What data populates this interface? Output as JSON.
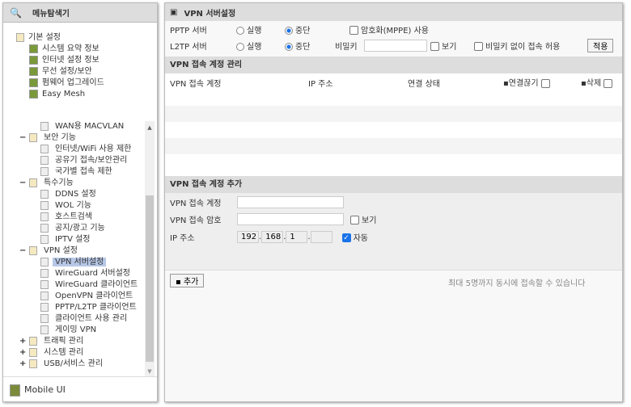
{
  "sidebar": {
    "title": "메뉴탐색기",
    "top_group": "기본 설정",
    "top_items": [
      "시스템 요약 정보",
      "인터넷 설정 정보",
      "무선 설정/보안",
      "펌웨어 업그레이드",
      "Easy Mesh"
    ],
    "scroll_items": [
      {
        "label": "WAN용 MACVLAN",
        "level": 2
      },
      {
        "label": "보안 기능",
        "level": 1,
        "toggle": "−"
      },
      {
        "label": "인터넷/WiFi 사용 제한",
        "level": 2
      },
      {
        "label": "공유기 접속/보안관리",
        "level": 2
      },
      {
        "label": "국가별 접속 제한",
        "level": 2
      },
      {
        "label": "특수기능",
        "level": 1,
        "toggle": "−"
      },
      {
        "label": "DDNS 설정",
        "level": 2
      },
      {
        "label": "WOL 기능",
        "level": 2
      },
      {
        "label": "호스트검색",
        "level": 2
      },
      {
        "label": "공지/광고 기능",
        "level": 2
      },
      {
        "label": "IPTV 설정",
        "level": 2
      },
      {
        "label": "VPN 설정",
        "level": 1,
        "toggle": "−"
      },
      {
        "label": "VPN 서버설정",
        "level": 2,
        "selected": true
      },
      {
        "label": "WireGuard 서버설정",
        "level": 2
      },
      {
        "label": "WireGuard 클라이언트",
        "level": 2
      },
      {
        "label": "OpenVPN 클라이언트",
        "level": 2
      },
      {
        "label": "PPTP/L2TP 클라이언트",
        "level": 2
      },
      {
        "label": "클라이언트 사용 관리",
        "level": 2
      },
      {
        "label": "게이밍 VPN",
        "level": 2
      },
      {
        "label": "트래픽 관리",
        "level": 1,
        "toggle": "+"
      },
      {
        "label": "시스템 관리",
        "level": 1,
        "toggle": "+"
      },
      {
        "label": "USB/서비스 관리",
        "level": 1,
        "toggle": "+"
      }
    ],
    "mobile": "Mobile UI"
  },
  "main": {
    "title": "VPN 서버설정",
    "pptp": {
      "label": "PPTP 서버",
      "run": "실행",
      "stop": "중단",
      "mppe": "암호화(MPPE) 사용"
    },
    "l2tp": {
      "label": "L2TP 서버",
      "run": "실행",
      "stop": "중단",
      "secret": "비밀키",
      "secret_value": "",
      "show": "보기",
      "no_secret": "비밀키 없이 접속 허용",
      "apply": "적용"
    },
    "manage": {
      "title": "VPN 접속 계정 관리",
      "cols": [
        "VPN 접속 계정",
        "IP 주소",
        "연결 상태",
        "연결끊기",
        "삭제"
      ]
    },
    "add": {
      "title": "VPN 접속 계정 추가",
      "account_label": "VPN 접속 계정",
      "account_value": "",
      "password_label": "VPN 접속 암호",
      "password_value": "",
      "show": "보기",
      "ip_label": "IP 주소",
      "ip": [
        "192",
        "168",
        "1",
        ""
      ],
      "auto": "자동",
      "add_button": "추가",
      "note": "최대 5명까지 동시에 접속할 수 있습니다"
    }
  }
}
